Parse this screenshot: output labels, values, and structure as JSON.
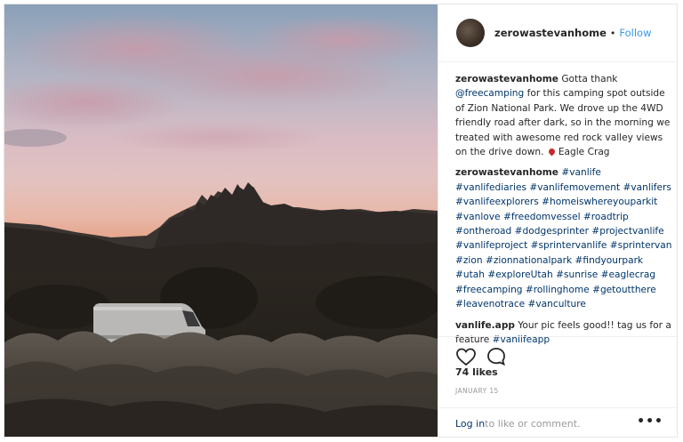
{
  "post": {
    "author": "zerowastevanhome",
    "dot": "•",
    "follow_label": "Follow",
    "comments": [
      {
        "user": "zerowastevanhome",
        "segments": [
          {
            "t": " Gotta thank "
          },
          {
            "t": "@freecamping",
            "tag": true
          },
          {
            "t": " for this camping spot outside of Zion National Park. We drove up the 4WD friendly road after dark, so in the morning we treated with awesome red rock valley views on the drive down. "
          },
          {
            "pin": true
          },
          {
            "t": "Eagle Crag"
          }
        ]
      },
      {
        "user": "zerowastevanhome",
        "segments": [
          {
            "t": " "
          },
          {
            "t": "#vanlife",
            "tag": true
          },
          {
            "t": " "
          },
          {
            "t": "#vanlifediaries",
            "tag": true
          },
          {
            "t": " "
          },
          {
            "t": "#vanlifemovement",
            "tag": true
          },
          {
            "t": " "
          },
          {
            "t": "#vanlifers",
            "tag": true
          },
          {
            "t": " "
          },
          {
            "t": "#vanlifeexplorers",
            "tag": true
          },
          {
            "t": " "
          },
          {
            "t": "#homeiswhereyouparkit",
            "tag": true
          },
          {
            "t": " "
          },
          {
            "t": "#vanlove",
            "tag": true
          },
          {
            "t": " "
          },
          {
            "t": "#freedomvessel",
            "tag": true
          },
          {
            "t": " "
          },
          {
            "t": "#roadtrip",
            "tag": true
          },
          {
            "t": " "
          },
          {
            "t": "#ontheroad",
            "tag": true
          },
          {
            "t": " "
          },
          {
            "t": "#dodgesprinter",
            "tag": true
          },
          {
            "t": " "
          },
          {
            "t": "#projectvanlife",
            "tag": true
          },
          {
            "t": " "
          },
          {
            "t": "#vanlifeproject",
            "tag": true
          },
          {
            "t": " "
          },
          {
            "t": "#sprintervanlife",
            "tag": true
          },
          {
            "t": " "
          },
          {
            "t": "#sprintervan",
            "tag": true
          },
          {
            "t": " "
          },
          {
            "t": "#zion",
            "tag": true
          },
          {
            "t": " "
          },
          {
            "t": "#zionnationalpark",
            "tag": true
          },
          {
            "t": " "
          },
          {
            "t": "#findyourpark",
            "tag": true
          },
          {
            "t": " "
          },
          {
            "t": "#utah",
            "tag": true
          },
          {
            "t": " "
          },
          {
            "t": "#exploreUtah",
            "tag": true
          },
          {
            "t": " "
          },
          {
            "t": "#sunrise",
            "tag": true
          },
          {
            "t": " "
          },
          {
            "t": "#eaglecrag",
            "tag": true
          },
          {
            "t": " "
          },
          {
            "t": "#freecamping",
            "tag": true
          },
          {
            "t": " "
          },
          {
            "t": "#rollinghome",
            "tag": true
          },
          {
            "t": " "
          },
          {
            "t": "#getoutthere",
            "tag": true
          },
          {
            "t": " "
          },
          {
            "t": "#leavenotrace",
            "tag": true
          },
          {
            "t": " "
          },
          {
            "t": "#vanculture",
            "tag": true
          }
        ]
      },
      {
        "user": "vanlife.app",
        "segments": [
          {
            "t": " Your pic feels good!! tag us for a feature "
          },
          {
            "t": "#vanlifeapp",
            "tag": true
          }
        ]
      }
    ],
    "likes": "74 likes",
    "date": "JANUARY 15",
    "login_link": "Log in",
    "login_text": " to like or comment.",
    "more_label": "•••"
  },
  "icons": {
    "like": "heart-icon",
    "comment": "comment-bubble-icon",
    "pin": "location-pin-icon",
    "more": "more-options-icon"
  },
  "colors": {
    "link": "#003569",
    "follow": "#3897f0",
    "muted": "#999999",
    "border": "#efefef"
  }
}
